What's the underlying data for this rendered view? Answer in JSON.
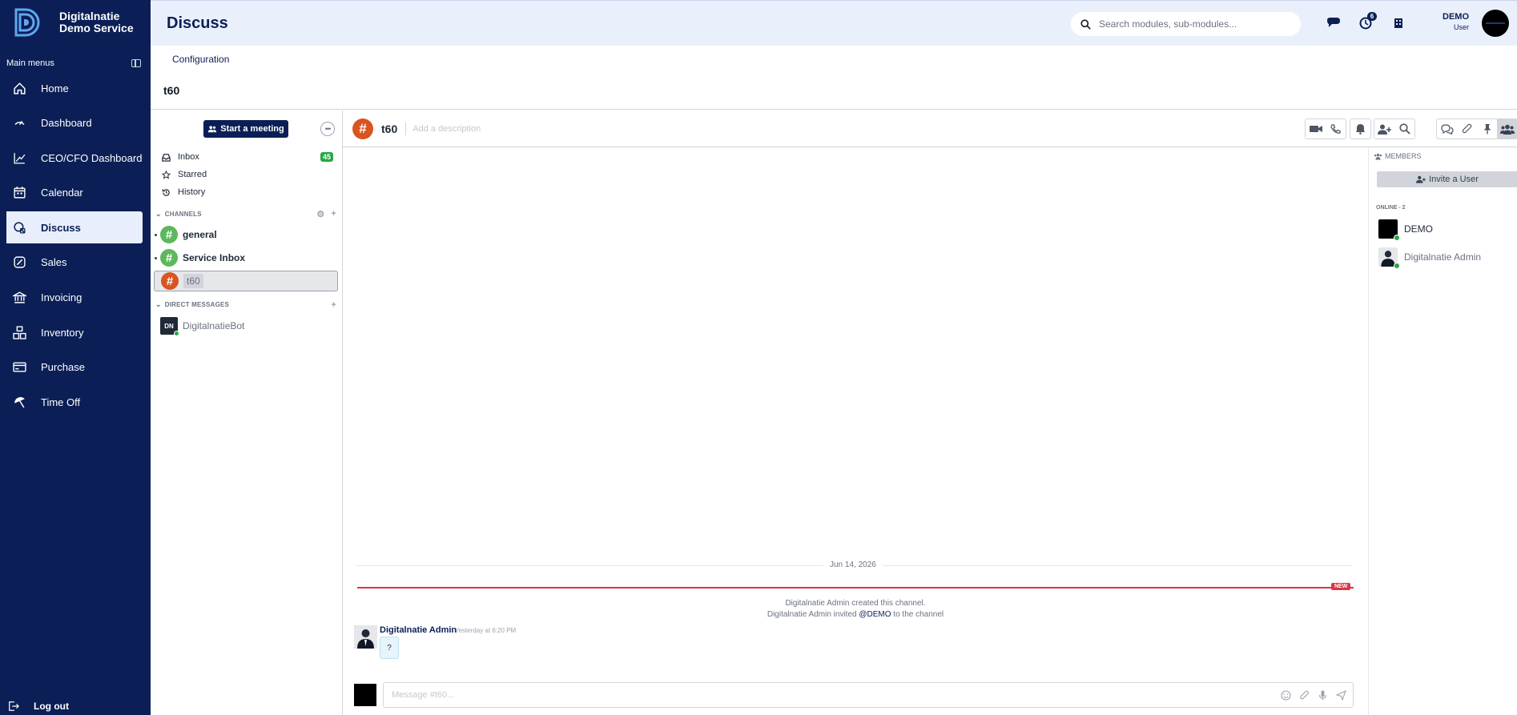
{
  "brand": {
    "line1": "Digitalnatie",
    "line2": "Demo Service"
  },
  "sidebar": {
    "header": "Main menus",
    "items": [
      {
        "label": "Home",
        "icon": "home-icon"
      },
      {
        "label": "Dashboard",
        "icon": "dashboard-icon"
      },
      {
        "label": "CEO/CFO Dashboard",
        "icon": "chart-line-icon"
      },
      {
        "label": "Calendar",
        "icon": "calendar-icon"
      },
      {
        "label": "Discuss",
        "icon": "discuss-icon",
        "active": true
      },
      {
        "label": "Sales",
        "icon": "sales-icon"
      },
      {
        "label": "Invoicing",
        "icon": "bank-icon"
      },
      {
        "label": "Inventory",
        "icon": "inventory-icon"
      },
      {
        "label": "Purchase",
        "icon": "card-icon"
      },
      {
        "label": "Time Off",
        "icon": "umbrella-icon"
      }
    ],
    "logout": "Log out"
  },
  "topbar": {
    "title": "Discuss",
    "search_placeholder": "Search modules, sub-modules...",
    "messages_badge": "",
    "activity_badge": "6",
    "user_name": "DEMO",
    "user_role": "User"
  },
  "control_panel": {
    "menu": "Configuration",
    "breadcrumb": "t60"
  },
  "discuss_sidebar": {
    "start_meeting": "Start a meeting",
    "mailboxes": [
      {
        "label": "Inbox",
        "count": "45"
      },
      {
        "label": "Starred"
      },
      {
        "label": "History"
      }
    ],
    "channels_header": "CHANNELS",
    "channels": [
      {
        "label": "general",
        "color": "#5cb85c"
      },
      {
        "label": "Service Inbox",
        "color": "#5cb85c"
      },
      {
        "label": "t60",
        "color": "#d9541e",
        "selected": true
      }
    ],
    "dm_header": "DIRECT MESSAGES",
    "dms": [
      {
        "label": "DigitalnatieBot",
        "initials": "DN"
      }
    ]
  },
  "thread": {
    "name": "t60",
    "description_placeholder": "Add a description",
    "date_separator": "Jun 14, 2026",
    "new_badge": "NEW",
    "notifications": [
      "Digitalnatie Admin created this channel."
    ],
    "invite_notice": {
      "pre": "Digitalnatie Admin invited ",
      "mention": "@DEMO",
      "post": " to the channel"
    },
    "message": {
      "author": "Digitalnatie Admin",
      "time": "Yesterday at 6:20 PM",
      "body": "?"
    },
    "composer_placeholder": "Message #t60..."
  },
  "members_panel": {
    "header": "MEMBERS",
    "invite": "Invite a User",
    "online_label": "ONLINE - 2",
    "members": [
      {
        "name": "DEMO"
      },
      {
        "name": "Digitalnatie Admin"
      }
    ]
  },
  "colors": {
    "brand_navy": "#0b1f56",
    "accent_green": "#28a745",
    "new_red": "#dc3545"
  }
}
